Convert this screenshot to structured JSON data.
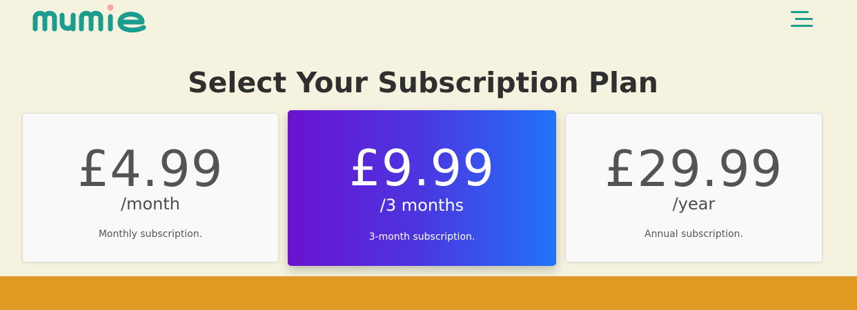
{
  "brand": {
    "name": "mumie",
    "colors": {
      "teal": "#1a9d8f",
      "dot": "#f2a7a0",
      "background": "#f5f3df",
      "footer": "#e09a24",
      "gradient_start": "#6a12cf",
      "gradient_end": "#2273f8"
    }
  },
  "header": {
    "menu_icon": "hamburger-menu-icon"
  },
  "main": {
    "title": "Select Your Subscription Plan",
    "plans": [
      {
        "price": "£4.99",
        "period": "/month",
        "description": "Monthly subscription.",
        "featured": false
      },
      {
        "price": "£9.99",
        "period": "/3 months",
        "description": "3-month subscription.",
        "featured": true
      },
      {
        "price": "£29.99",
        "period": "/year",
        "description": "Annual subscription.",
        "featured": false
      }
    ]
  }
}
